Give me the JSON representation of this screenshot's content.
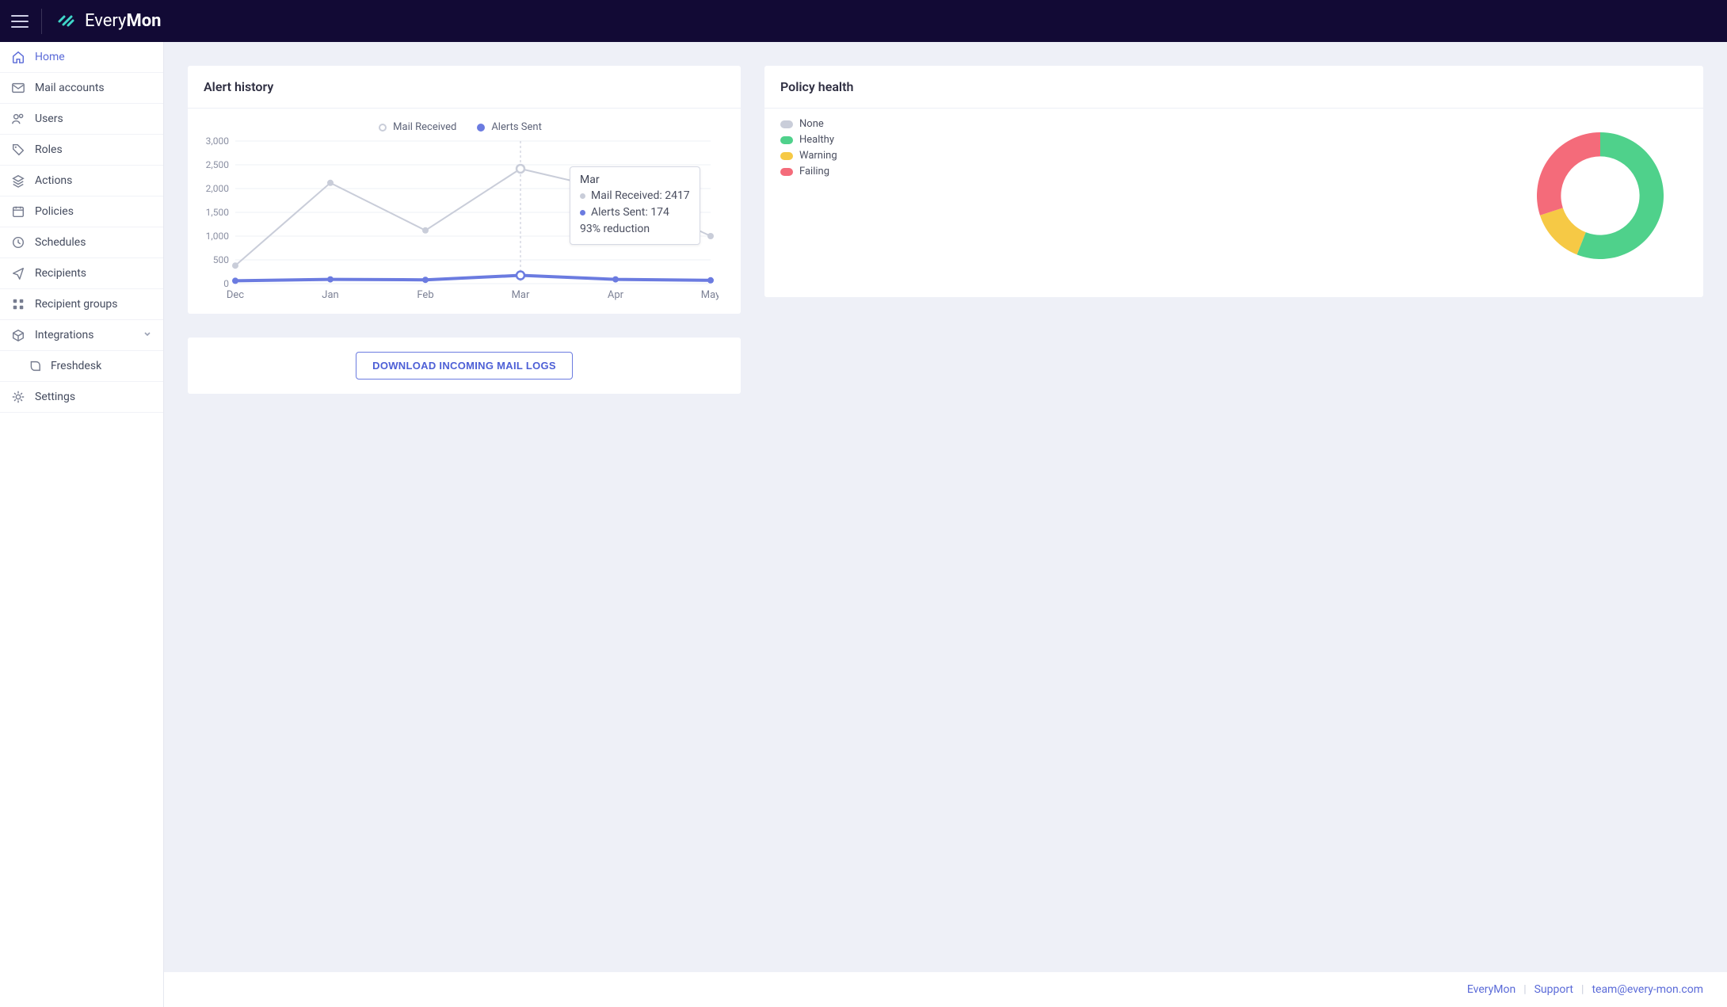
{
  "brand": {
    "textLight": "Every",
    "textBold": "Mon"
  },
  "sidebar": {
    "items": [
      {
        "label": "Home",
        "icon": "home",
        "active": true
      },
      {
        "label": "Mail accounts",
        "icon": "mail"
      },
      {
        "label": "Users",
        "icon": "users"
      },
      {
        "label": "Roles",
        "icon": "tag"
      },
      {
        "label": "Actions",
        "icon": "layers"
      },
      {
        "label": "Policies",
        "icon": "calendar"
      },
      {
        "label": "Schedules",
        "icon": "clock"
      },
      {
        "label": "Recipients",
        "icon": "send"
      },
      {
        "label": "Recipient groups",
        "icon": "grid"
      },
      {
        "label": "Integrations",
        "icon": "box",
        "expandable": true
      },
      {
        "label": "Freshdesk",
        "icon": "freshdesk",
        "sub": true
      },
      {
        "label": "Settings",
        "icon": "gear"
      }
    ]
  },
  "alertHistory": {
    "title": "Alert history",
    "legend": {
      "mail": "Mail Received",
      "alerts": "Alerts Sent"
    },
    "tooltip": {
      "title": "Mar",
      "mailLabel": "Mail Received: 2417",
      "alertsLabel": "Alerts Sent: 174",
      "reduction": "93% reduction"
    },
    "download": "DOWNLOAD INCOMING MAIL LOGS"
  },
  "policyHealth": {
    "title": "Policy health",
    "legend": {
      "none": "None",
      "healthy": "Healthy",
      "warning": "Warning",
      "failing": "Failing"
    }
  },
  "footer": {
    "brand": "EveryMon",
    "support": "Support",
    "email": "team@every-mon.com"
  },
  "colors": {
    "blue": "#6b7be0",
    "grey": "#c9cdd9",
    "none": "#c9cdd9",
    "healthy": "#4fd18b",
    "warning": "#f6c945",
    "failing": "#f46b7a"
  },
  "chart_data": [
    {
      "type": "line",
      "title": "Alert history",
      "xlabel": "",
      "ylabel": "",
      "categories": [
        "Dec",
        "Jan",
        "Feb",
        "Mar",
        "Apr",
        "May"
      ],
      "ylim": [
        0,
        3000
      ],
      "yticks": [
        0,
        500,
        1000,
        1500,
        2000,
        2500,
        3000
      ],
      "series": [
        {
          "name": "Mail Received",
          "color": "#c9cdd9",
          "values": [
            380,
            2120,
            1120,
            2417,
            1950,
            1000
          ]
        },
        {
          "name": "Alerts Sent",
          "color": "#6b7be0",
          "values": [
            60,
            90,
            80,
            174,
            90,
            70
          ]
        }
      ],
      "hover_index": 3,
      "hover_reduction_pct": 93
    },
    {
      "type": "pie",
      "title": "Policy health",
      "hole": 0.62,
      "series": [
        {
          "name": "None",
          "value": 0,
          "color": "#c9cdd9"
        },
        {
          "name": "Healthy",
          "value": 56,
          "color": "#4fd18b"
        },
        {
          "name": "Warning",
          "value": 14,
          "color": "#f6c945"
        },
        {
          "name": "Failing",
          "value": 30,
          "color": "#f46b7a"
        }
      ]
    }
  ]
}
